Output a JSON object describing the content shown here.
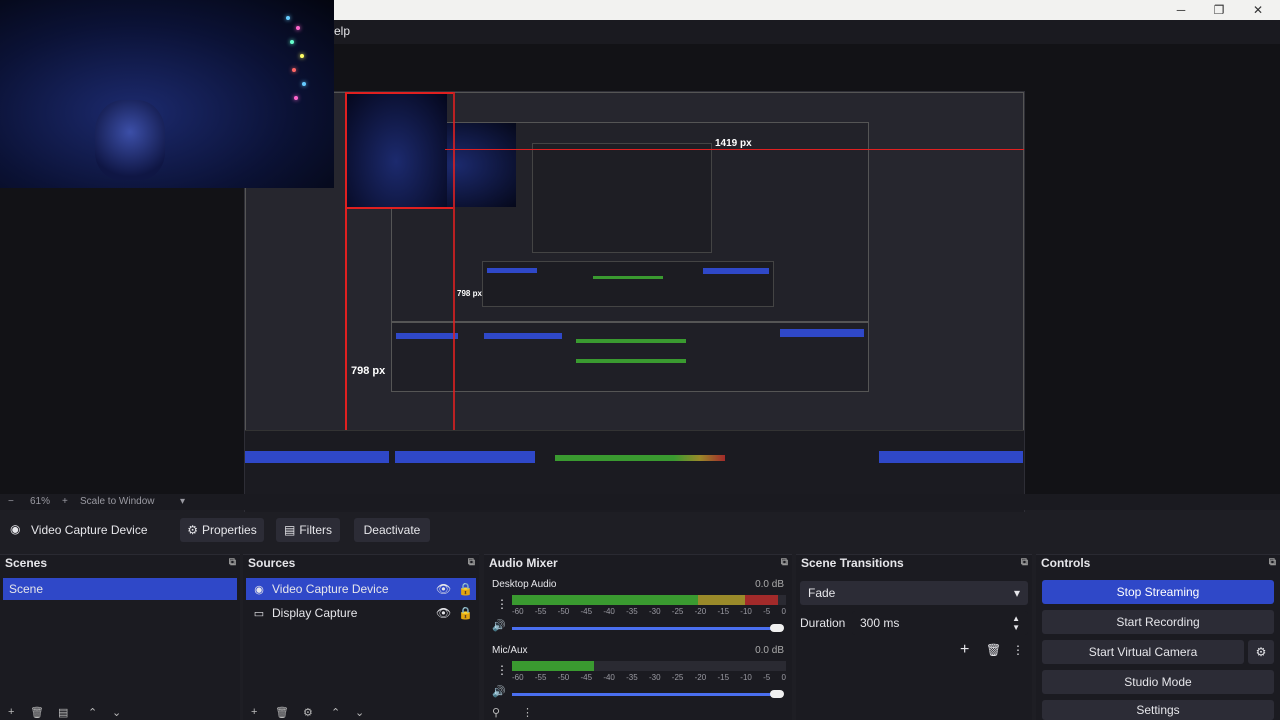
{
  "window": {
    "minimize_icon": "minimize-icon",
    "maximize_icon": "restore-icon",
    "close_icon": "close-icon",
    "menu_partial": "elp"
  },
  "preview_overlay": {
    "width_label": "1419 px",
    "height_label_large": "798 px",
    "height_label_small": "798 px"
  },
  "scale_bar": {
    "zoom_minus": "−",
    "zoom_value": "61%",
    "zoom_plus": "+",
    "scale_mode": "Scale to Window"
  },
  "source_toolbar": {
    "source_name": "Video Capture Device",
    "properties_label": "Properties",
    "filters_label": "Filters",
    "deactivate_label": "Deactivate"
  },
  "scenes": {
    "title": "Scenes",
    "items": [
      {
        "label": "Scene",
        "selected": true
      }
    ]
  },
  "sources": {
    "title": "Sources",
    "items": [
      {
        "label": "Video Capture Device",
        "icon": "camera-icon",
        "selected": true
      },
      {
        "label": "Display Capture",
        "icon": "monitor-icon",
        "selected": false
      }
    ]
  },
  "audio_mixer": {
    "title": "Audio Mixer",
    "ticks": [
      "-60",
      "-55",
      "-50",
      "-45",
      "-40",
      "-35",
      "-30",
      "-25",
      "-20",
      "-15",
      "-10",
      "-5",
      "0"
    ],
    "channels": [
      {
        "name": "Desktop Audio",
        "level": "0.0 dB",
        "meter_fill": 0.97
      },
      {
        "name": "Mic/Aux",
        "level": "0.0 dB",
        "meter_fill": 0.3
      }
    ]
  },
  "scene_transitions": {
    "title": "Scene Transitions",
    "transition": "Fade",
    "duration_label": "Duration",
    "duration_value": "300 ms"
  },
  "controls": {
    "title": "Controls",
    "stop_streaming": "Stop Streaming",
    "start_recording": "Start Recording",
    "start_virtual_camera": "Start Virtual Camera",
    "studio_mode": "Studio Mode",
    "settings": "Settings"
  },
  "colors": {
    "accent": "#2f48c8",
    "meter_green": "#3a9a30",
    "meter_yellow": "#9a8a2a",
    "meter_red": "#a22a2a",
    "guide_red": "#e02020"
  }
}
